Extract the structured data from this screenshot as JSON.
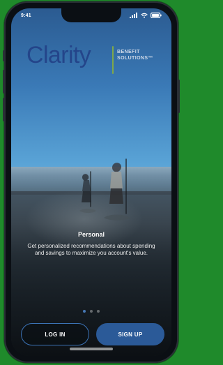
{
  "status_bar": {
    "time": "9:41",
    "icons": [
      "cellular-signal-icon",
      "wifi-icon",
      "battery-icon"
    ]
  },
  "brand": {
    "name": "Clarity",
    "subtitle_line1": "BENEFIT",
    "subtitle_line2": "SOLUTIONS™",
    "divider_color": "#7fa84a",
    "name_color": "#24458a"
  },
  "slide": {
    "title": "Personal",
    "body": "Get personalized recommendations about spending and savings to maximize you account's value."
  },
  "pagination": {
    "count": 3,
    "active_index": 0
  },
  "actions": {
    "login_label": "LOG IN",
    "signup_label": "SIGN UP",
    "accent_color": "#2b5a98"
  }
}
